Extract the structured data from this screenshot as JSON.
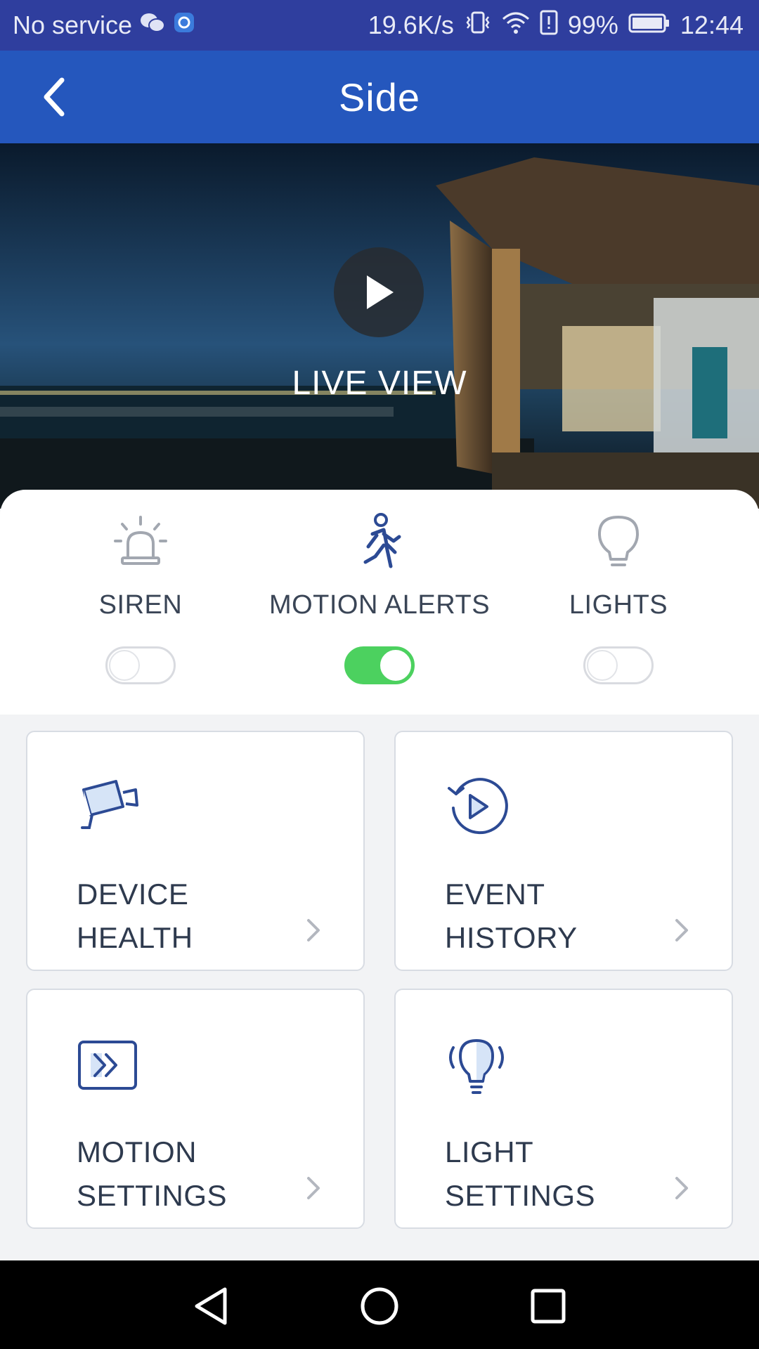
{
  "status_bar": {
    "carrier": "No service",
    "net_speed": "19.6K/s",
    "battery": "99%",
    "time": "12:44",
    "icons": [
      "wechat-icon",
      "circle-app-icon",
      "vibrate-icon",
      "wifi-icon",
      "alert-icon",
      "battery-icon"
    ]
  },
  "app_bar": {
    "title": "Side",
    "back_icon": "back-chevron-icon"
  },
  "live_view": {
    "label": "LIVE VIEW",
    "play_icon": "play-icon"
  },
  "controls": [
    {
      "label": "SIREN",
      "icon": "siren-icon",
      "on": false
    },
    {
      "label": "MOTION ALERTS",
      "icon": "running-person-icon",
      "on": true
    },
    {
      "label": "LIGHTS",
      "icon": "bulb-icon",
      "on": false
    }
  ],
  "tiles": [
    {
      "line1": "DEVICE",
      "line2": "HEALTH",
      "icon": "camera-icon"
    },
    {
      "line1": "EVENT",
      "line2": "HISTORY",
      "icon": "history-play-icon"
    },
    {
      "line1": "MOTION",
      "line2": "SETTINGS",
      "icon": "motion-forward-icon"
    },
    {
      "line1": "LIGHT",
      "line2": "SETTINGS",
      "icon": "light-bulb-icon"
    }
  ],
  "colors": {
    "status_bar": "#2f3e9e",
    "app_bar": "#2557bd",
    "toggle_on": "#4cd15f",
    "icon_blue": "#2c4a94"
  }
}
